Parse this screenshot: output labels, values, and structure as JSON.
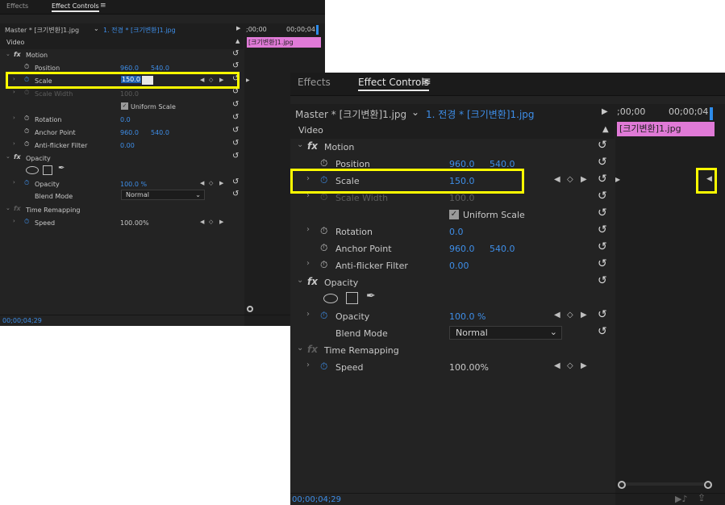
{
  "tabs": {
    "effects": "Effects",
    "effect_controls": "Effect Controls"
  },
  "header": {
    "master_label": "Master * [크기변환]1.jpg",
    "sequence_label": "1. 전경 * [크기변환]1.jpg",
    "time_start": ";00;00",
    "time_end": "00;00;04"
  },
  "clip_label": "[크기변환]1.jpg",
  "section_video": "Video",
  "motion": {
    "label": "Motion",
    "position": {
      "label": "Position",
      "x": "960.0",
      "y": "540.0"
    },
    "scale": {
      "label": "Scale",
      "value": "150.0"
    },
    "scale_width": {
      "label": "Scale Width",
      "value": "100.0"
    },
    "uniform_scale": "Uniform Scale",
    "rotation": {
      "label": "Rotation",
      "value": "0.0"
    },
    "anchor_point": {
      "label": "Anchor Point",
      "x": "960.0",
      "y": "540.0"
    },
    "anti_flicker": {
      "label": "Anti-flicker Filter",
      "value": "0.00"
    }
  },
  "opacity": {
    "label": "Opacity",
    "opacity_row": {
      "label": "Opacity",
      "value": "100.0 %"
    },
    "blend_mode": {
      "label": "Blend Mode",
      "value": "Normal"
    }
  },
  "time_remapping": {
    "label": "Time Remapping",
    "speed": {
      "label": "Speed",
      "value": "100.00%"
    }
  },
  "footer": {
    "timecode": "00;00;04;29"
  },
  "colors": {
    "highlight": "#ffff00",
    "accent_blue": "#3e8ee8",
    "clip_pink": "#e07ad7"
  }
}
